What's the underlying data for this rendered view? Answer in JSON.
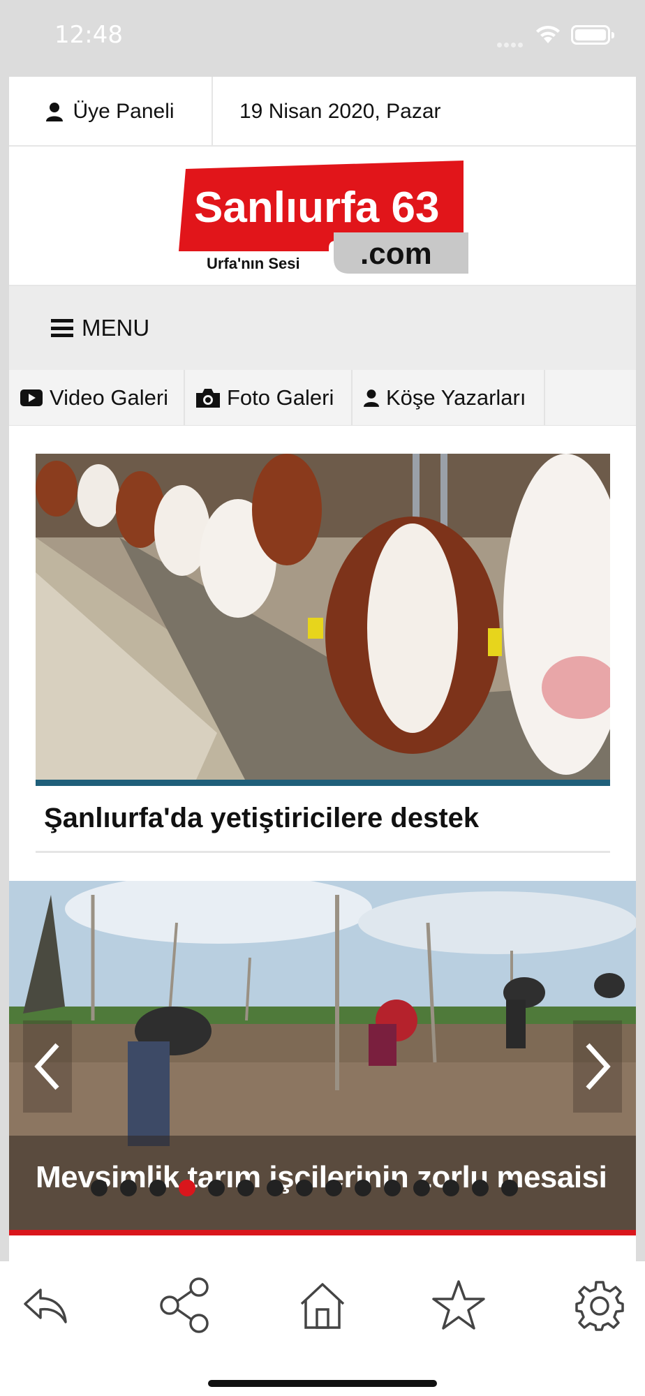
{
  "status_bar": {
    "time": "12:48"
  },
  "topbar": {
    "member_panel_label": "Üye Paneli",
    "date": "19 Nisan 2020, Pazar"
  },
  "logo": {
    "name": "Sanlıurfa 63",
    "domain": ".com",
    "tagline": "Urfa'nın Sesi",
    "colors": {
      "red": "#e1151a",
      "gray": "#c8c8c8"
    }
  },
  "menu": {
    "label": "MENU"
  },
  "categories": [
    {
      "label": "Video Galeri",
      "icon": "play-icon"
    },
    {
      "label": "Foto Galeri",
      "icon": "camera-icon"
    },
    {
      "label": "Köşe Yazarları",
      "icon": "user-icon"
    }
  ],
  "featured_news": {
    "title": "Şanlıurfa'da yetiştiricilere destek",
    "image": "cows-feeding-photo"
  },
  "slider": {
    "caption": "Mevsimlik tarım işçilerinin zorlu mesaisi",
    "image": "farm-workers-field-photo",
    "total_slides": 15,
    "active_index": 3
  },
  "bottom_nav": [
    {
      "name": "back",
      "icon": "reply-icon"
    },
    {
      "name": "share",
      "icon": "share-icon"
    },
    {
      "name": "home",
      "icon": "home-icon"
    },
    {
      "name": "favorites",
      "icon": "star-icon"
    },
    {
      "name": "settings",
      "icon": "gear-icon"
    }
  ],
  "colors": {
    "accent_red": "#d9161c",
    "accent_blue": "#1f5f7a"
  }
}
